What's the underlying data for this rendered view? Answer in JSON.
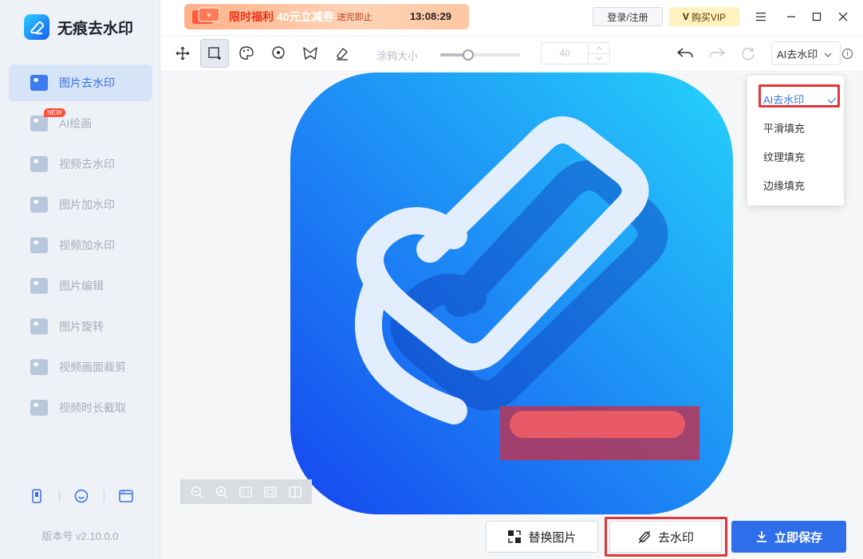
{
  "app": {
    "name": "无痕去水印",
    "version": "版本号 v2.10.0.0"
  },
  "sidebar": {
    "items": [
      {
        "label": "图片去水印",
        "icon": "image-watermark-icon",
        "active": true
      },
      {
        "label": "AI绘画",
        "icon": "ai-paint-icon",
        "badge": "NEW"
      },
      {
        "label": "视频去水印",
        "icon": "video-watermark-icon"
      },
      {
        "label": "图片加水印",
        "icon": "image-add-watermark-icon"
      },
      {
        "label": "视频加水印",
        "icon": "video-add-watermark-icon"
      },
      {
        "label": "图片编辑",
        "icon": "image-edit-icon"
      },
      {
        "label": "图片旋转",
        "icon": "image-rotate-icon"
      },
      {
        "label": "视频画面裁剪",
        "icon": "video-crop-icon"
      },
      {
        "label": "视频时长截取",
        "icon": "video-trim-icon"
      }
    ],
    "tools": [
      "phone-icon",
      "smile-icon",
      "window-icon"
    ]
  },
  "titlebar": {
    "promo_main": "限时福利",
    "promo_amount": "40元立减券",
    "promo_note": "送完即止",
    "promo_timer": "13:08:29",
    "login_label": "登录/注册",
    "vip_label": "购买VIP",
    "vip_mark": "V"
  },
  "toolbar": {
    "brush_label": "涂鸦大小",
    "brush_value": "40",
    "brush_level": 0.35,
    "mode_label": "AI去水印"
  },
  "dropdown": {
    "options": [
      "AI去水印",
      "平滑填充",
      "纹理填充",
      "边缘填充"
    ],
    "selected": "AI去水印"
  },
  "actions": {
    "replace_label": "替换图片",
    "remove_label": "去水印",
    "save_label": "立即保存"
  },
  "colors": {
    "accent": "#2f6eea",
    "highlight": "#e0363a",
    "sidebar_bg": "#eef1f6"
  }
}
